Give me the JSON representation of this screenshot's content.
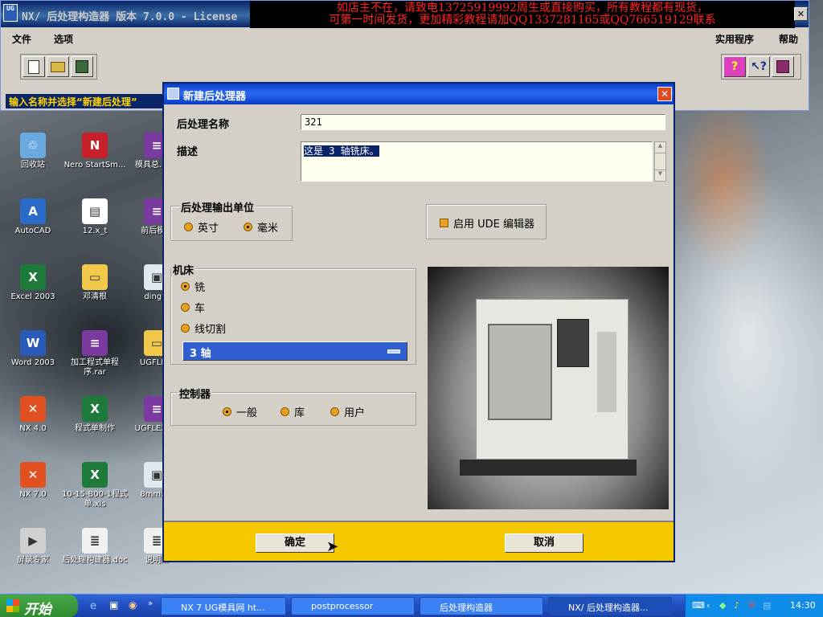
{
  "app": {
    "title": "NX/ 后处理构造器 版本 7.0.0 - License",
    "notice_line1": "如店主不在，请致电13725919992周生或直接购买，所有教程都有现货，",
    "notice_line2": "可第一时间发货，更加精彩教程请加QQ1337281165或QQ766519129联系",
    "close_label": "✕",
    "menu": {
      "file": "文件",
      "options": "选项",
      "utilities": "实用程序",
      "help": "帮助"
    },
    "prompt": "输入名称并选择“新建后处理”"
  },
  "dialog": {
    "title": "新建后处理器",
    "close_label": "✕",
    "name_label": "后处理名称",
    "name_value": "321",
    "desc_label": "描述",
    "desc_value": "这是 3 轴铣床。",
    "units": {
      "label": "后处理输出单位",
      "inch": "英寸",
      "mm": "毫米",
      "selected": "毫米"
    },
    "ude_label": "启用 UDE 编辑器",
    "machine": {
      "label": "机床",
      "mill": "铣",
      "lathe": "车",
      "wire": "线切割",
      "selected": "铣",
      "axis_value": "3 轴"
    },
    "controller": {
      "label": "控制器",
      "generic": "一般",
      "library": "库",
      "user": "用户",
      "selected": "一般"
    },
    "ok_label": "确定",
    "cancel_label": "取消"
  },
  "desktop_icons": [
    {
      "label": "回收站",
      "icon": "recycle-bin-icon"
    },
    {
      "label": "Nero StartSm...",
      "icon": "nero-icon"
    },
    {
      "label": "模具总...rar",
      "icon": "rar-icon"
    },
    {
      "label": "AutoCAD",
      "icon": "autocad-icon"
    },
    {
      "label": "12.x_t",
      "icon": "file-icon"
    },
    {
      "label": "前后模...",
      "icon": "rar-icon"
    },
    {
      "label": "Excel 2003",
      "icon": "excel-icon"
    },
    {
      "label": "邓清根",
      "icon": "folder-icon"
    },
    {
      "label": "ding...",
      "icon": "image-icon"
    },
    {
      "label": "Word 2003",
      "icon": "word-icon"
    },
    {
      "label": "加工程式单程序.rar",
      "icon": "rar-icon"
    },
    {
      "label": "UGFLE...",
      "icon": "folder-icon"
    },
    {
      "label": "NX 4.0",
      "icon": "nx-icon"
    },
    {
      "label": "程式单制作",
      "icon": "excel-icon"
    },
    {
      "label": "UGFLEXL...",
      "icon": "rar-icon"
    },
    {
      "label": "NX 7.0",
      "icon": "nx-icon"
    },
    {
      "label": "10-15-B00-1程式单.xls",
      "icon": "excel-icon"
    },
    {
      "label": "8mm.j...",
      "icon": "image-icon"
    },
    {
      "label": "屏录专家",
      "icon": "recorder-icon"
    },
    {
      "label": "后处理构建器.doc",
      "icon": "doc-icon"
    },
    {
      "label": "说明...",
      "icon": "doc-icon"
    }
  ],
  "taskbar": {
    "start": "开始",
    "tasks": [
      "NX 7 UG模具网 ht...",
      "postprocessor",
      "后处理构造器",
      "NX/ 后处理构造器..."
    ],
    "clock": "14:30"
  }
}
